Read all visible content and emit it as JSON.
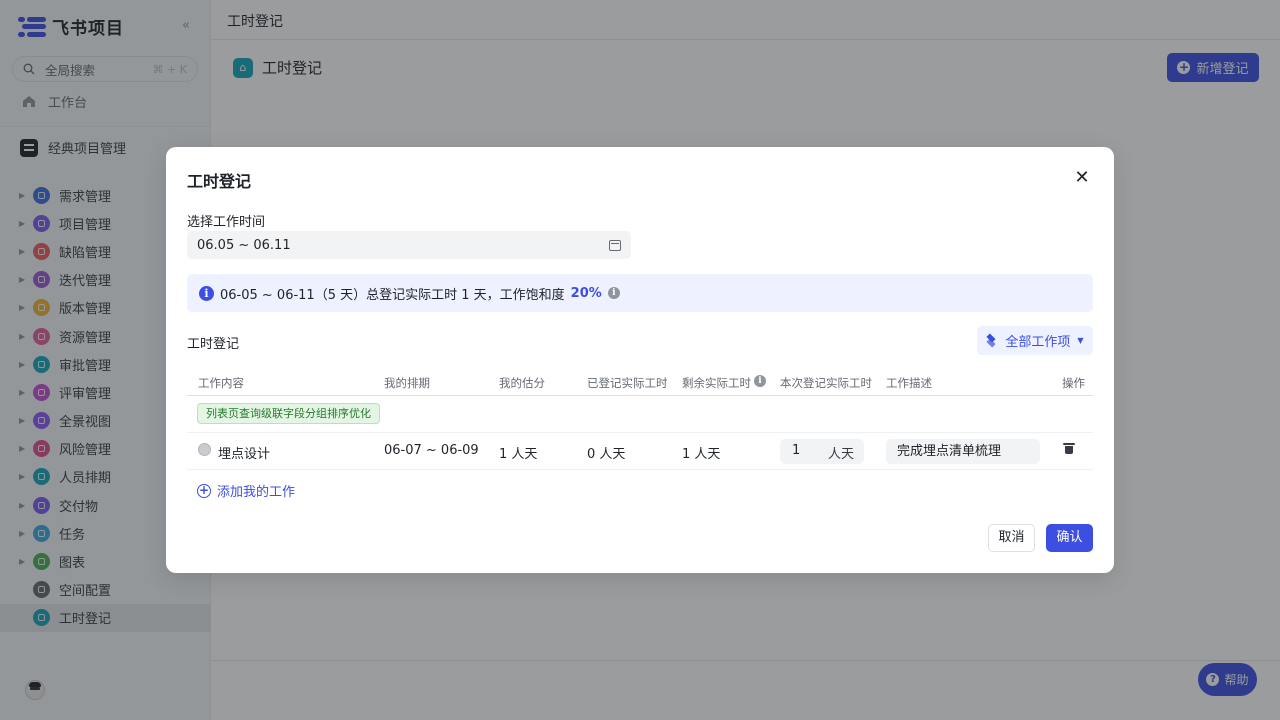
{
  "app": {
    "name": "飞书项目",
    "collapse_glyph": "«"
  },
  "search": {
    "placeholder": "全局搜索",
    "shortcut": "⌘ + K"
  },
  "nav": {
    "workbench": "工作台"
  },
  "space": {
    "name": "经典项目管理"
  },
  "sidebar": {
    "items": [
      {
        "label": "需求管理",
        "color": "#3c6ee0",
        "expandable": true
      },
      {
        "label": "项目管理",
        "color": "#7a5cf0",
        "expandable": true
      },
      {
        "label": "缺陷管理",
        "color": "#f05c5c",
        "expandable": true
      },
      {
        "label": "迭代管理",
        "color": "#9b59d6",
        "expandable": true
      },
      {
        "label": "版本管理",
        "color": "#f2b233",
        "expandable": true
      },
      {
        "label": "资源管理",
        "color": "#e25f9b",
        "expandable": true
      },
      {
        "label": "审批管理",
        "color": "#14a7b8",
        "expandable": true
      },
      {
        "label": "评审管理",
        "color": "#c24fd0",
        "expandable": true
      },
      {
        "label": "全景视图",
        "color": "#8b5cf6",
        "expandable": true
      },
      {
        "label": "风险管理",
        "color": "#e04f8c",
        "expandable": true
      },
      {
        "label": "人员排期",
        "color": "#14a7b8",
        "expandable": true
      },
      {
        "label": "交付物",
        "color": "#7a5cf0",
        "expandable": true
      },
      {
        "label": "任务",
        "color": "#3aa8e0",
        "expandable": true
      },
      {
        "label": "图表",
        "color": "#4caf50",
        "expandable": true
      },
      {
        "label": "空间配置",
        "color": "#646a73",
        "expandable": false
      },
      {
        "label": "工时登记",
        "color": "#14a7b8",
        "expandable": false,
        "active": true
      }
    ]
  },
  "main": {
    "breadcrumb": "工时登记",
    "page_title": "工时登记",
    "new_button": "新增登记",
    "help_button": "帮助"
  },
  "modal": {
    "title": "工时登记",
    "date_label": "选择工作时间",
    "date_value": "06.05 ~ 06.11",
    "info_text": "06-05 ~ 06-11（5 天）总登记实际工时 1 天，工作饱和度",
    "info_percent": "20%",
    "section_title": "工时登记",
    "filter_button": "全部工作项",
    "columns": [
      "工作内容",
      "我的排期",
      "我的估分",
      "已登记实际工时",
      "剩余实际工时",
      "本次登记实际工时",
      "工作描述",
      "操作"
    ],
    "group_tag": "列表页查询级联字段分组排序优化",
    "row": {
      "name": "埋点设计",
      "schedule": "06-07 ~ 06-09",
      "estimate": "1 人天",
      "logged": "0 人天",
      "remaining": "1 人天",
      "current_value": "1",
      "current_unit": "人天",
      "description": "完成埋点清单梳理"
    },
    "add_work": "添加我的工作",
    "cancel": "取消",
    "confirm": "确认"
  }
}
